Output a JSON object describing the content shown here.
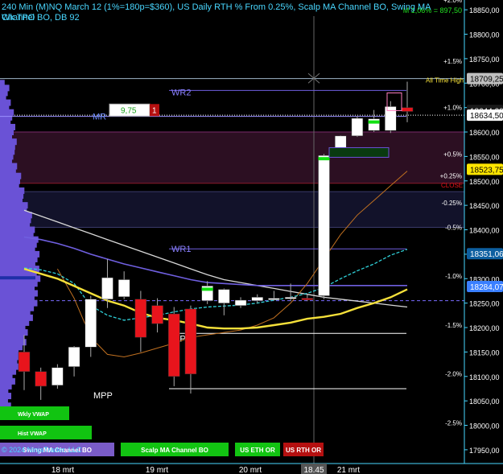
{
  "header": {
    "line1": "240 Min (M)NQ March 12 (1%=180p=$360), US Daily RTH % From 0.25%, Scalp MA Channel BO, Swing MA Channel BO, DB 92",
    "line2": "Wk TPO",
    "corner_pct": "M 1,06% = 897,50",
    "copyright": "© 2024 NinjaTrader, LLC"
  },
  "colors": {
    "background": "#000000",
    "bull_candle": "#ffffff",
    "bear_candle": "#e8141c",
    "yellow_ma": "#f5e03a",
    "cyan_ma": "#2fd0d8",
    "purple_ma": "#6f5fe0",
    "tpo_profile": "#6a52d6",
    "orange_line": "#c07020"
  },
  "levels": {
    "wr2": "WR2",
    "mr": "MR",
    "wr1": "WR1",
    "wpp": "WPP",
    "mpp": "MPP",
    "all_time_high": "All Time High",
    "close": "CLOSE"
  },
  "order_box": {
    "qty": "9,75",
    "count": "1"
  },
  "chart_data": {
    "type": "candlestick",
    "title": "240 Min (M)NQ March 12",
    "x_ticks": [
      "18 mrt",
      "19 mrt",
      "20 mrt",
      "21 mrt"
    ],
    "time_marker": "18.45",
    "y_ticks": [
      "18850,00",
      "18800,00",
      "18750,00",
      "18700,00",
      "18650,00",
      "18600,00",
      "18550,00",
      "18500,00",
      "18450,00",
      "18400,00",
      "18350,00",
      "18300,00",
      "18250,00",
      "18200,00",
      "18150,00",
      "18100,00",
      "18050,00",
      "18000,00",
      "17950,00"
    ],
    "ylim": [
      17935,
      18870
    ],
    "pct_labels": [
      {
        "text": "+2.0%",
        "value": 18870
      },
      {
        "text": "+1.5%",
        "value": 18745
      },
      {
        "text": "+1.0%",
        "value": 18650
      },
      {
        "text": "+0.5%",
        "value": 18555
      },
      {
        "text": "+0.25%",
        "value": 18510
      },
      {
        "text": "-0.25%",
        "value": 18455
      },
      {
        "text": "-0.5%",
        "value": 18405
      },
      {
        "text": "-1.0%",
        "value": 18305
      },
      {
        "text": "-1.5%",
        "value": 18205
      },
      {
        "text": "-2.0%",
        "value": 18105
      },
      {
        "text": "-2.5%",
        "value": 18005
      }
    ],
    "price_tags": [
      {
        "text": "18709,25",
        "value": 18709.25,
        "bg": "#bfbfbf",
        "fg": "#000000"
      },
      {
        "text": "18644,00",
        "value": 18644,
        "bg": "#1a1a1a",
        "fg": "#ffffff"
      },
      {
        "text": "18634,50",
        "value": 18634.5,
        "bg": "#ffffff",
        "fg": "#000000"
      },
      {
        "text": "18523,75",
        "value": 18523.75,
        "bg": "#ffe600",
        "fg": "#000000"
      },
      {
        "text": "18351,06",
        "value": 18351.06,
        "bg": "#0d5fa0",
        "fg": "#ffffff"
      },
      {
        "text": "18284,07",
        "value": 18284.07,
        "bg": "#3a7fff",
        "fg": "#ffffff"
      }
    ],
    "horizontal_lines": [
      {
        "label": "WR2",
        "value": 18685,
        "color": "#6f5fe0"
      },
      {
        "label": "MR",
        "value": 18632,
        "color": "#9a8fff"
      },
      {
        "label": "WR1",
        "value": 18361,
        "color": "#6f5fe0"
      },
      {
        "label": "WPP",
        "value": 18188,
        "color": "#ffffff"
      },
      {
        "label": "MPP",
        "value": 18075,
        "color": "#ffffff"
      }
    ],
    "candles": [
      {
        "o": 18150,
        "h": 18185,
        "c": 18110,
        "l": 18072
      },
      {
        "o": 18110,
        "h": 18118,
        "c": 18080,
        "l": 18052
      },
      {
        "o": 18082,
        "h": 18125,
        "c": 18118,
        "l": 18075
      },
      {
        "o": 18120,
        "h": 18162,
        "c": 18160,
        "l": 18100
      },
      {
        "o": 18160,
        "h": 18265,
        "c": 18258,
        "l": 18140
      },
      {
        "o": 18258,
        "h": 18340,
        "c": 18302,
        "l": 18240
      },
      {
        "o": 18263,
        "h": 18315,
        "c": 18298,
        "l": 18258
      },
      {
        "o": 18258,
        "h": 18275,
        "c": 18180,
        "l": 18150
      },
      {
        "o": 18245,
        "h": 18260,
        "c": 18208,
        "l": 18190
      },
      {
        "o": 18228,
        "h": 18242,
        "c": 18100,
        "l": 18080
      },
      {
        "o": 18238,
        "h": 18245,
        "c": 18105,
        "l": 18065
      },
      {
        "o": 18255,
        "h": 18295,
        "c": 18285,
        "l": 18248
      },
      {
        "o": 18250,
        "h": 18280,
        "c": 18278,
        "l": 18225
      },
      {
        "o": 18245,
        "h": 18262,
        "c": 18256,
        "l": 18240
      },
      {
        "o": 18255,
        "h": 18268,
        "c": 18262,
        "l": 18250
      },
      {
        "o": 18260,
        "h": 18275,
        "c": 18260,
        "l": 18255
      },
      {
        "o": 18260,
        "h": 18290,
        "c": 18262,
        "l": 18254
      },
      {
        "o": 18260,
        "h": 18268,
        "c": 18258,
        "l": 18254
      },
      {
        "o": 18265,
        "h": 18555,
        "c": 18552,
        "l": 18258
      },
      {
        "o": 18555,
        "h": 18593,
        "c": 18592,
        "l": 18548
      },
      {
        "o": 18592,
        "h": 18632,
        "c": 18628,
        "l": 18590
      },
      {
        "o": 18603,
        "h": 18645,
        "c": 18627,
        "l": 18600
      },
      {
        "o": 18603,
        "h": 18663,
        "c": 18652,
        "l": 18598
      },
      {
        "o": 18650,
        "h": 18703,
        "c": 18642,
        "l": 18620
      }
    ],
    "series": [
      {
        "name": "yellow",
        "values": [
          18320,
          18310,
          18300,
          18285,
          18270,
          18255,
          18245,
          18230,
          18220,
          18215,
          18208,
          18200,
          18198,
          18198,
          18200,
          18205,
          18210,
          18218,
          18222,
          18228,
          18240,
          18250,
          18262,
          18278
        ]
      },
      {
        "name": "cyan",
        "values": [
          18322,
          18318,
          18310,
          18290,
          18245,
          18225,
          18215,
          18220,
          18225,
          18232,
          18238,
          18242,
          18244,
          18246,
          18250,
          18256,
          18262,
          18270,
          18282,
          18300,
          18316,
          18330,
          18348,
          18360
        ]
      },
      {
        "name": "purple",
        "values": [
          18385,
          18380,
          18372,
          18362,
          18350,
          18340,
          18330,
          18322,
          18314,
          18306,
          18298,
          18292,
          18290,
          18288,
          18286,
          18286,
          18286,
          18286,
          18286,
          18286,
          18286,
          18286,
          18286,
          18286
        ]
      },
      {
        "name": "white_trend",
        "values": [
          18440,
          18428,
          18416,
          18404,
          18392,
          18380,
          18368,
          18356,
          18344,
          18332,
          18320,
          18308,
          18298,
          18292,
          18286,
          18280,
          18274,
          18268,
          18262,
          18258,
          18254,
          18250,
          18246,
          18242
        ]
      },
      {
        "name": "orange",
        "values": [
          null,
          null,
          18320,
          18260,
          18180,
          18145,
          18140,
          18148,
          18158,
          18168,
          18180,
          18185,
          18190,
          18195,
          18205,
          18220,
          18250,
          18290,
          18340,
          18390,
          18430,
          18460,
          18490,
          18520
        ]
      }
    ]
  },
  "bottom_buttons": [
    {
      "label": "Wkly VWAP",
      "color": "#11c411"
    },
    {
      "label": "Hist VWAP",
      "color": "#11c411"
    },
    {
      "label": "Swing MA Channel BO",
      "color": "#7a5cc8"
    },
    {
      "label": "Scalp MA Channel BO",
      "color": "#12c412"
    },
    {
      "label": "US ETH OR",
      "color": "#12c412"
    },
    {
      "label": "US RTH OR",
      "color": "#b51010"
    }
  ]
}
